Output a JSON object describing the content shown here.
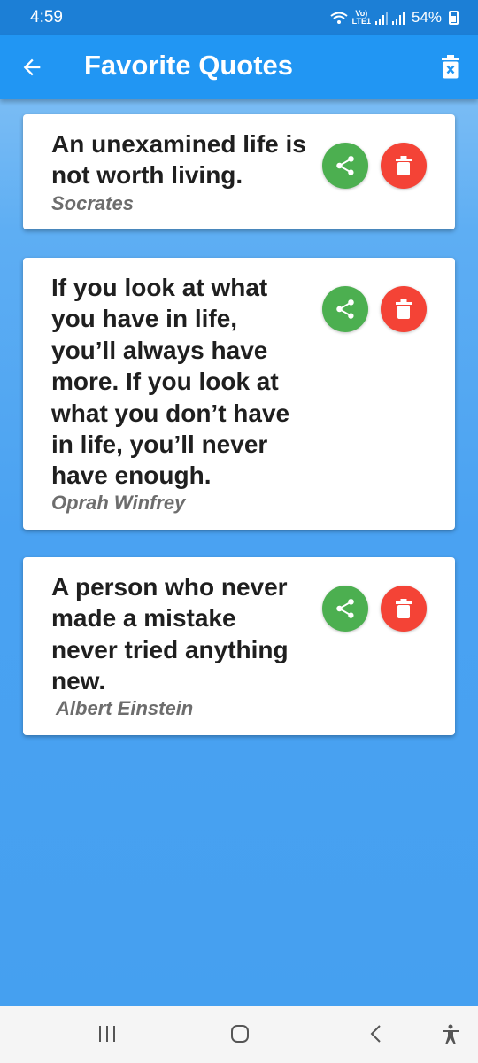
{
  "status_bar": {
    "time": "4:59",
    "network_label_top": "Vo)",
    "network_label_bottom": "LTE1",
    "battery_percent": "54%"
  },
  "app_bar": {
    "title": "Favorite Quotes",
    "back_icon": "arrow-back-icon",
    "clear_icon": "clear-all-trash-icon",
    "color": "#2196F3"
  },
  "quotes": [
    {
      "text": "An unexamined life is not worth living.",
      "author": "Socrates"
    },
    {
      "text": "If you look at what you have in life, you’ll always have more. If you look at what you don’t have in life, you’ll never have enough.",
      "author": "Oprah Winfrey"
    },
    {
      "text": "A person who never made a mistake never tried anything new.",
      "author": "Albert Einstein"
    }
  ],
  "actions": {
    "share_icon": "share-icon",
    "share_color": "#4CAF50",
    "delete_icon": "trash-icon",
    "delete_color": "#F44336"
  },
  "nav_bar": {
    "items": [
      "recent-apps-icon",
      "home-icon",
      "back-icon",
      "accessibility-icon"
    ]
  }
}
